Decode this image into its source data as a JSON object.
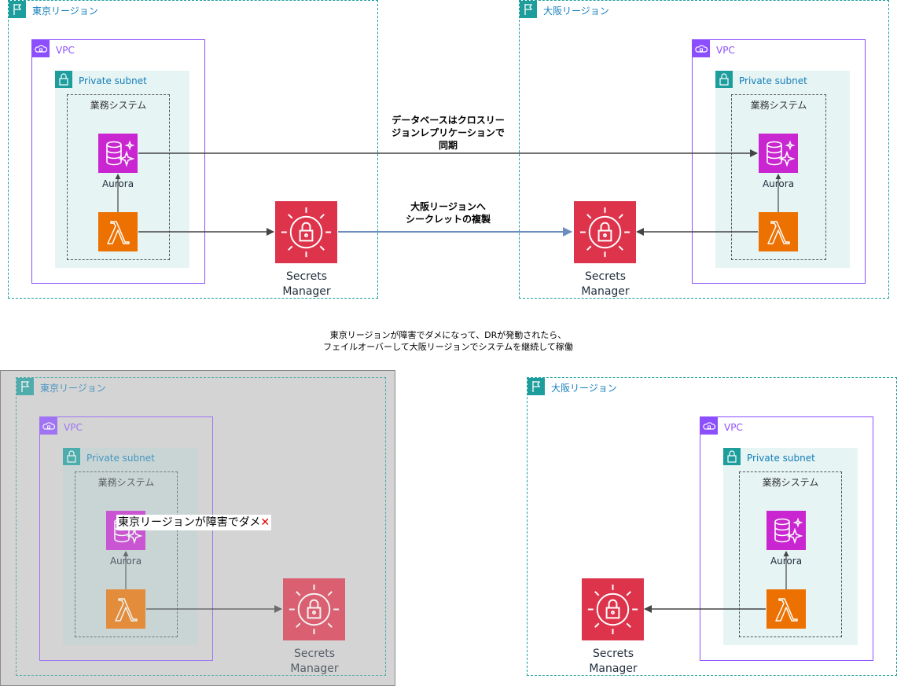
{
  "diagram": {
    "top": {
      "tokyo_region": {
        "label": "東京リージョン"
      },
      "tokyo_vpc": {
        "label": "VPC"
      },
      "tokyo_subnet": {
        "label": "Private subnet"
      },
      "tokyo_system": {
        "label": "業務システム"
      },
      "tokyo_aurora": {
        "label": "Aurora"
      },
      "tokyo_secrets": {
        "label_line1": "Secrets",
        "label_line2": "Manager"
      },
      "osaka_region": {
        "label": "大阪リージョン"
      },
      "osaka_vpc": {
        "label": "VPC"
      },
      "osaka_subnet": {
        "label": "Private subnet"
      },
      "osaka_system": {
        "label": "業務システム"
      },
      "osaka_aurora": {
        "label": "Aurora"
      },
      "osaka_secrets": {
        "label_line1": "Secrets",
        "label_line2": "Manager"
      },
      "db_replication_note": {
        "line1": "データベースはクロスリー",
        "line2": "ジョンレプリケーションで",
        "line3": "同期"
      },
      "secret_replication_note": {
        "line1": "大阪リージョンへ",
        "line2": "シークレットの複製"
      }
    },
    "middle_note": {
      "line1": "東京リージョンが障害でダメになって、DRが発動されたら、",
      "line2": "フェイルオーバーして大阪リージョンでシステムを継続して稼働"
    },
    "bottom": {
      "tokyo_region": {
        "label": "東京リージョン"
      },
      "tokyo_vpc": {
        "label": "VPC"
      },
      "tokyo_subnet": {
        "label": "Private subnet"
      },
      "tokyo_system": {
        "label": "業務システム"
      },
      "tokyo_aurora": {
        "label": "Aurora"
      },
      "tokyo_secrets": {
        "label_line1": "Secrets",
        "label_line2": "Manager"
      },
      "failure_label": {
        "text": "東京リージョンが障害でダメ",
        "mark": "✕"
      },
      "osaka_region": {
        "label": "大阪リージョン"
      },
      "osaka_vpc": {
        "label": "VPC"
      },
      "osaka_subnet": {
        "label": "Private subnet"
      },
      "osaka_system": {
        "label": "業務システム"
      },
      "osaka_aurora": {
        "label": "Aurora"
      },
      "osaka_secrets": {
        "label_line1": "Secrets",
        "label_line2": "Manager"
      }
    }
  },
  "icons": {
    "region": "flag-icon",
    "vpc": "cloud-vpc-icon",
    "subnet": "padlock-icon",
    "aurora": "aurora-database-icon",
    "lambda": "lambda-icon",
    "secrets_manager": "secrets-manager-icon"
  },
  "colors": {
    "region_border": "#1e9d9d",
    "vpc_border": "#8c4fff",
    "subnet_fill": "#e6f4f4",
    "aurora": "#c925d1",
    "lambda": "#ed7100",
    "secrets_manager": "#dd344c",
    "replication_arrow": "#6c8ebf",
    "failed_region_fill": "#d4d4d4"
  }
}
